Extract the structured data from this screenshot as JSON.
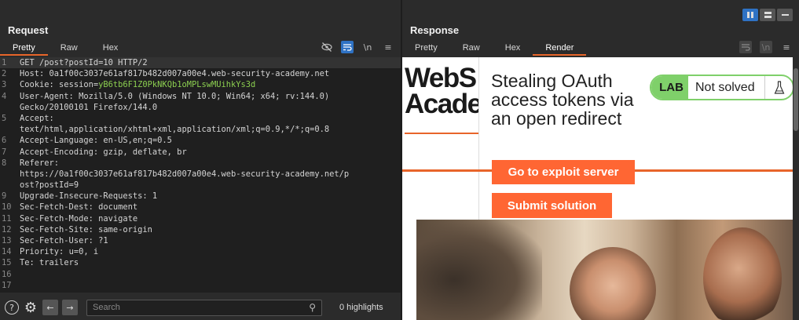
{
  "layout_buttons": [
    "split-vertical",
    "split-horizontal",
    "tabs"
  ],
  "request": {
    "title": "Request",
    "tabs": [
      "Pretty",
      "Raw",
      "Hex"
    ],
    "active_tab": "Pretty",
    "toolbar_icons": [
      "eye-off-icon",
      "wrap-icon",
      "newline-icon",
      "menu-icon"
    ],
    "newline_label": "\\n",
    "lines": [
      {
        "num": "1",
        "text": "GET /post?postId=10 HTTP/2"
      },
      {
        "num": "2",
        "name": "Host:",
        "value": " 0a1f00c3037e61af817b482d007a00e4.web-security-academy.net"
      },
      {
        "num": "3",
        "name": "Cookie:",
        "value": " session=",
        "highlight": "yB6tb6F1Z0PkNKQb1oMPLswMUihkYs3d"
      },
      {
        "num": "4",
        "name": "User-Agent:",
        "value": " Mozilla/5.0 (Windows NT 10.0; Win64; x64; rv:144.0)"
      },
      {
        "num": "",
        "value": "Gecko/20100101 Firefox/144.0"
      },
      {
        "num": "5",
        "name": "Accept:",
        "value": ""
      },
      {
        "num": "",
        "value": "text/html,application/xhtml+xml,application/xml;q=0.9,*/*;q=0.8"
      },
      {
        "num": "6",
        "name": "Accept-Language:",
        "value": " en-US,en;q=0.5"
      },
      {
        "num": "7",
        "name": "Accept-Encoding:",
        "value": " gzip, deflate, br"
      },
      {
        "num": "8",
        "name": "Referer:",
        "value": ""
      },
      {
        "num": "",
        "value": "https://0a1f00c3037e61af817b482d007a00e4.web-security-academy.net/p"
      },
      {
        "num": "",
        "value": "ost?postId=9"
      },
      {
        "num": "9",
        "name": "Upgrade-Insecure-Requests:",
        "value": " 1"
      },
      {
        "num": "10",
        "name": "Sec-Fetch-Dest:",
        "value": " document"
      },
      {
        "num": "11",
        "name": "Sec-Fetch-Mode:",
        "value": " navigate"
      },
      {
        "num": "12",
        "name": "Sec-Fetch-Site:",
        "value": " same-origin"
      },
      {
        "num": "13",
        "name": "Sec-Fetch-User:",
        "value": " ?1"
      },
      {
        "num": "14",
        "name": "Priority:",
        "value": " u=0, i"
      },
      {
        "num": "15",
        "name": "Te:",
        "value": " trailers"
      },
      {
        "num": "16",
        "value": ""
      },
      {
        "num": "17",
        "value": ""
      }
    ],
    "search_placeholder": "Search",
    "highlights_text": "0 highlights"
  },
  "response": {
    "title": "Response",
    "tabs": [
      "Pretty",
      "Raw",
      "Hex",
      "Render"
    ],
    "active_tab": "Render",
    "newline_label": "\\n",
    "render": {
      "logo_line1": "WebS",
      "logo_line2": "Acade",
      "lab_title": "Stealing OAuth access tokens via an open redirect",
      "lab_label": "LAB",
      "lab_status": "Not solved",
      "exploit_button": "Go to exploit server",
      "submit_button": "Submit solution"
    }
  },
  "colors": {
    "accent_orange": "#e8652a",
    "button_orange": "#ff6633",
    "lab_green": "#7fd06a",
    "active_blue": "#2f72c4",
    "session_green": "#8ccf50"
  }
}
